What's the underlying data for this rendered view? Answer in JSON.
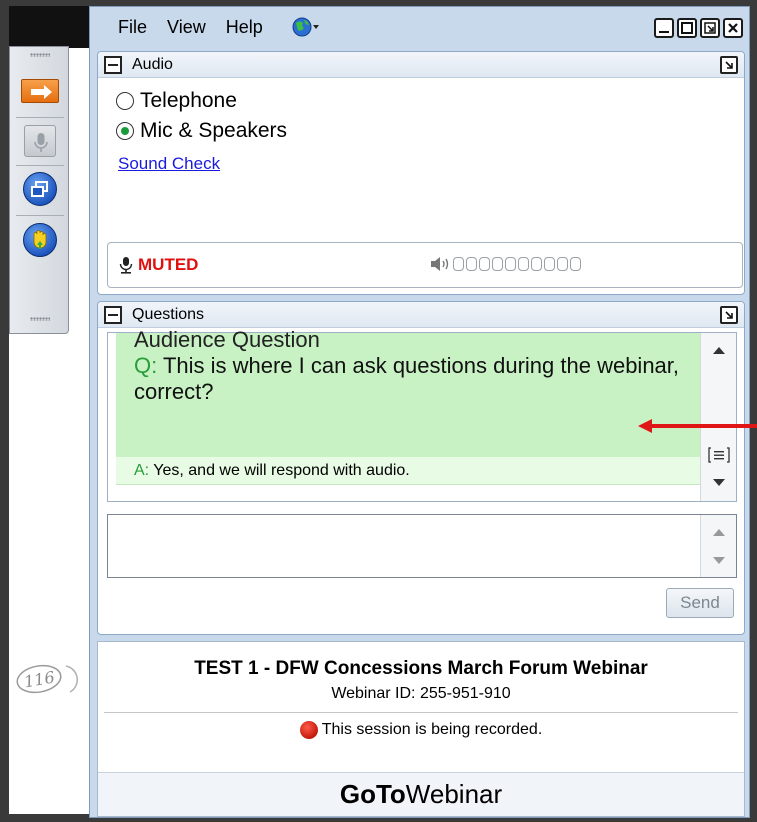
{
  "menu": {
    "file": "File",
    "view": "View",
    "help": "Help"
  },
  "audio": {
    "title": "Audio",
    "option_telephone": "Telephone",
    "option_mic": "Mic & Speakers",
    "selected": "Mic & Speakers",
    "sound_check": "Sound Check",
    "status": "MUTED"
  },
  "questions": {
    "title": "Questions",
    "heading": "Audience Question",
    "q_prefix": "Q:",
    "question_text": "This is where I can ask questions during the webinar, correct?",
    "a_prefix": "A:",
    "answer_text": "Yes, and we  will respond with audio.",
    "input_value": "",
    "send_label": "Send"
  },
  "session": {
    "title": "TEST 1 - DFW Concessions March Forum Webinar",
    "webinar_id": "Webinar ID: 255-951-910",
    "recording_text": "This session is being recorded."
  },
  "brand": {
    "bold": "GoTo",
    "regular": "Webinar"
  },
  "stamp_text": "116",
  "colors": {
    "muted_red": "#e01010",
    "accent_green": "#2a9d3a",
    "question_bg": "#c8f2c4",
    "link_blue": "#1a1adf"
  }
}
